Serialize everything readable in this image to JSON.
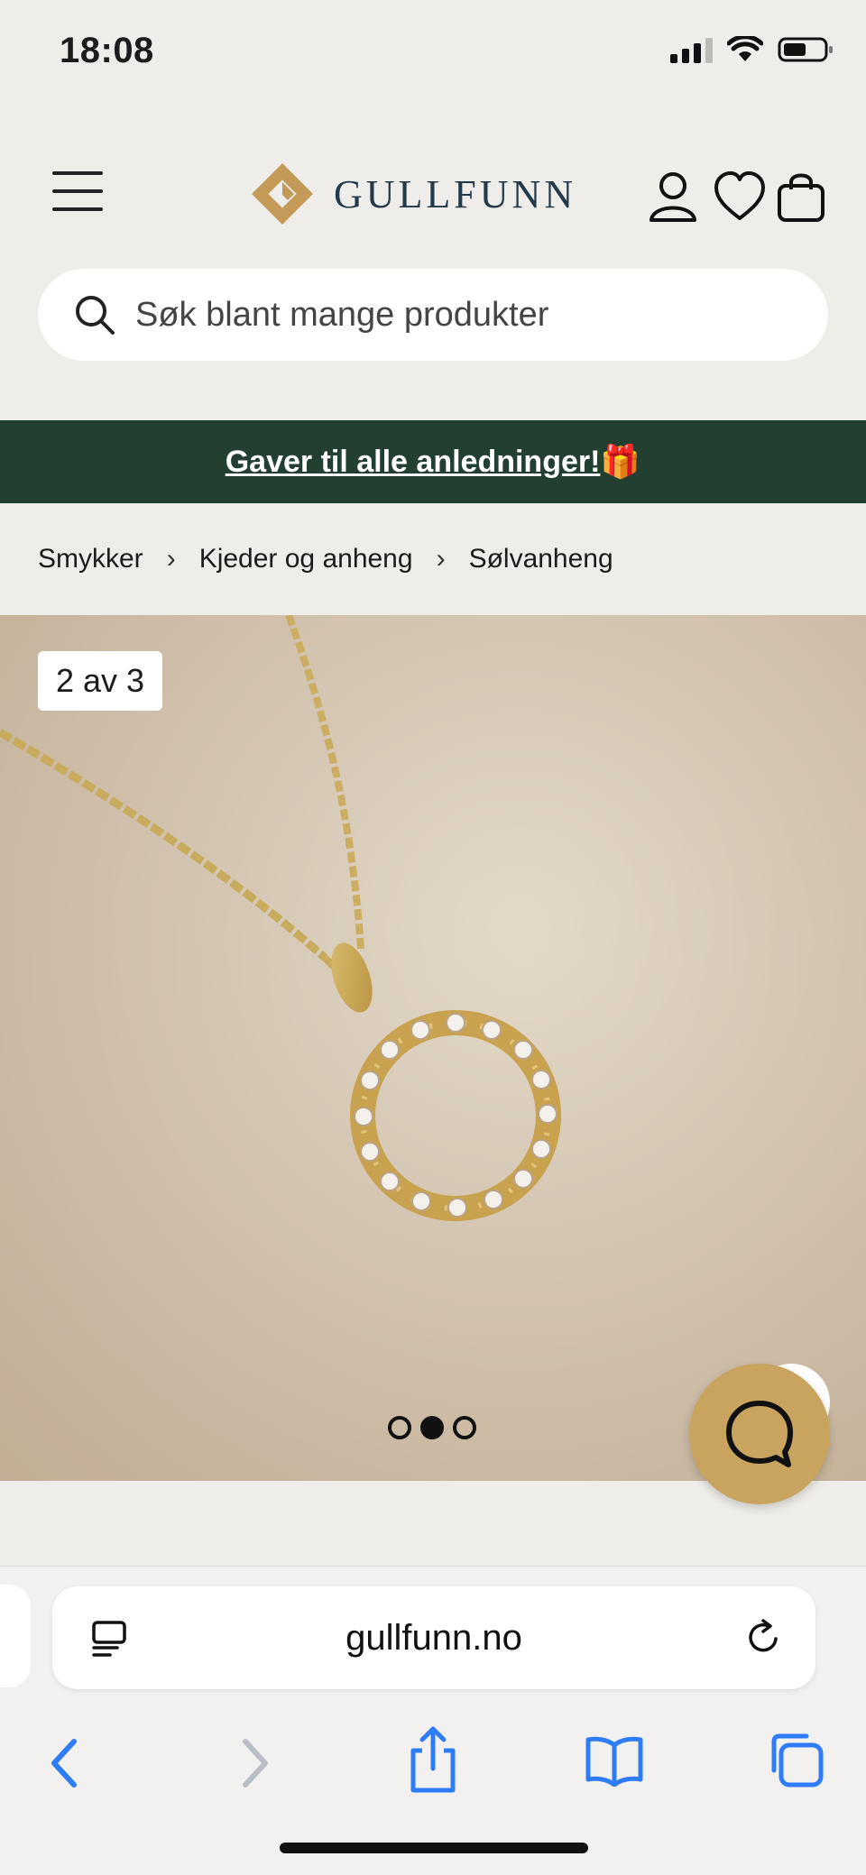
{
  "status_bar": {
    "time": "18:08",
    "icons": [
      "cellular-signal-icon",
      "wifi-icon",
      "battery-icon"
    ]
  },
  "header": {
    "logo_text": "GULLFUNN",
    "icons": [
      "menu-icon",
      "account-icon",
      "wishlist-heart-icon",
      "shopping-bag-icon"
    ]
  },
  "search": {
    "placeholder": "Søk blant mange produkter"
  },
  "promo": {
    "text": "Gaver til alle anledninger!",
    "emoji": "🎁",
    "background": "#233f32"
  },
  "breadcrumb": {
    "items": [
      "Smykker",
      "Kjeder og anheng",
      "Sølvanheng"
    ]
  },
  "gallery": {
    "counter": "2 av 3",
    "current_slide": 2,
    "total_slides": 3
  },
  "chat": {
    "icon": "chat-bubble-icon",
    "color": "#c8a45f"
  },
  "browser": {
    "url": "gullfunn.no",
    "icons": [
      "reader-mode-icon",
      "reload-icon",
      "back-icon",
      "forward-icon",
      "share-icon",
      "bookmarks-icon",
      "tabs-icon"
    ]
  },
  "colors": {
    "brand_gold": "#c8a45f",
    "brand_navy": "#233a4a",
    "banner_green": "#233f32",
    "safari_blue": "#2f7df6"
  }
}
